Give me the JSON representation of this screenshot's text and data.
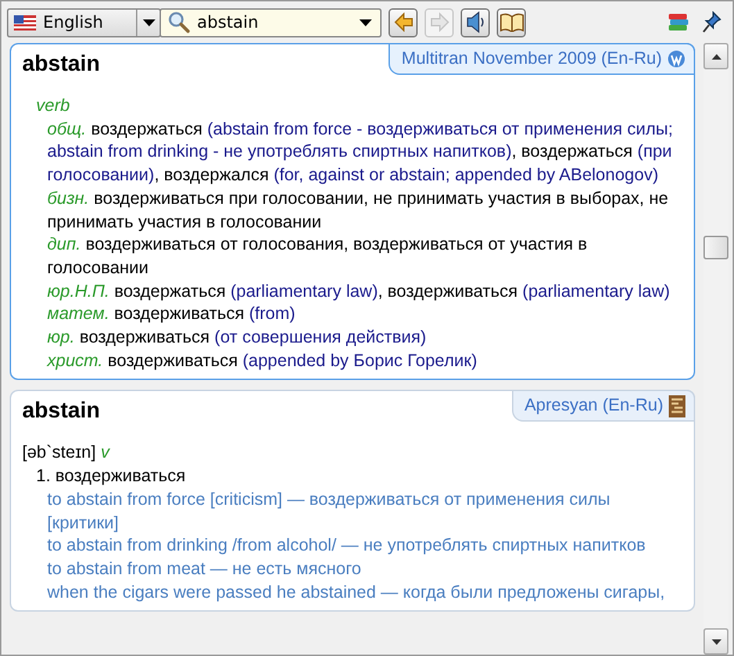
{
  "toolbar": {
    "language": "English",
    "search": {
      "value": "abstain"
    },
    "buttons": [
      {
        "kind": "back",
        "disabled": false
      },
      {
        "kind": "forward",
        "disabled": true
      },
      {
        "kind": "sound",
        "disabled": false
      },
      {
        "kind": "book",
        "disabled": false
      }
    ]
  },
  "cards": [
    {
      "kind": "multitran",
      "active": true,
      "headword": "abstain",
      "source": "Multitran November 2009 (En-Ru)",
      "pos": "verb",
      "entries": [
        {
          "subject": "общ.",
          "parts": [
            {
              "kind": "text",
              "text": "воздержаться "
            },
            {
              "kind": "note",
              "text": "(abstain from force - воздерживаться от применения силы; abstain from drinking - не употреблять спиртных напитков)"
            },
            {
              "kind": "text",
              "text": ", воздержаться "
            },
            {
              "kind": "note",
              "text": "(при голосовании)"
            },
            {
              "kind": "text",
              "text": ", воздержался "
            },
            {
              "kind": "note",
              "text": "(for, against or abstain; appended by ABelonogov)"
            }
          ]
        },
        {
          "subject": "бизн.",
          "parts": [
            {
              "kind": "text",
              "text": "воздерживаться при голосовании, не принимать участия в выборах, не принимать участия в голосовании"
            }
          ]
        },
        {
          "subject": "дип.",
          "parts": [
            {
              "kind": "text",
              "text": "воздерживаться от голосования, воздерживаться от участия в голосовании"
            }
          ]
        },
        {
          "subject": "юр.Н.П.",
          "parts": [
            {
              "kind": "text",
              "text": "воздержаться "
            },
            {
              "kind": "note",
              "text": "(parliamentary law)"
            },
            {
              "kind": "text",
              "text": ", воздерживаться "
            },
            {
              "kind": "note",
              "text": "(parliamentary law)"
            }
          ]
        },
        {
          "subject": "матем.",
          "parts": [
            {
              "kind": "text",
              "text": "воздерживаться "
            },
            {
              "kind": "note",
              "text": "(from)"
            }
          ]
        },
        {
          "subject": "юр.",
          "parts": [
            {
              "kind": "text",
              "text": "воздерживаться "
            },
            {
              "kind": "note",
              "text": "(от совершения действия)"
            }
          ]
        },
        {
          "subject": "христ.",
          "parts": [
            {
              "kind": "text",
              "text": "воздерживаться "
            },
            {
              "kind": "note",
              "text": "(appended by Борис Горелик)"
            }
          ]
        }
      ]
    },
    {
      "kind": "apresyan",
      "active": false,
      "headword": "abstain",
      "source": "Apresyan (En-Ru)",
      "transcription": "[əb`steɪn]",
      "pos": "v",
      "senses": [
        {
          "number": "1.",
          "translation": "воздерживаться",
          "examples": [
            "to abstain from force [criticism] — воздерживаться от применения силы [критики]",
            "to abstain from drinking /from alcohol/ — не употреблять спиртных напитков",
            "to abstain from meat — не есть мясного",
            "when the cigars were passed he abstained — когда были предложены сигары,"
          ]
        }
      ]
    }
  ]
}
